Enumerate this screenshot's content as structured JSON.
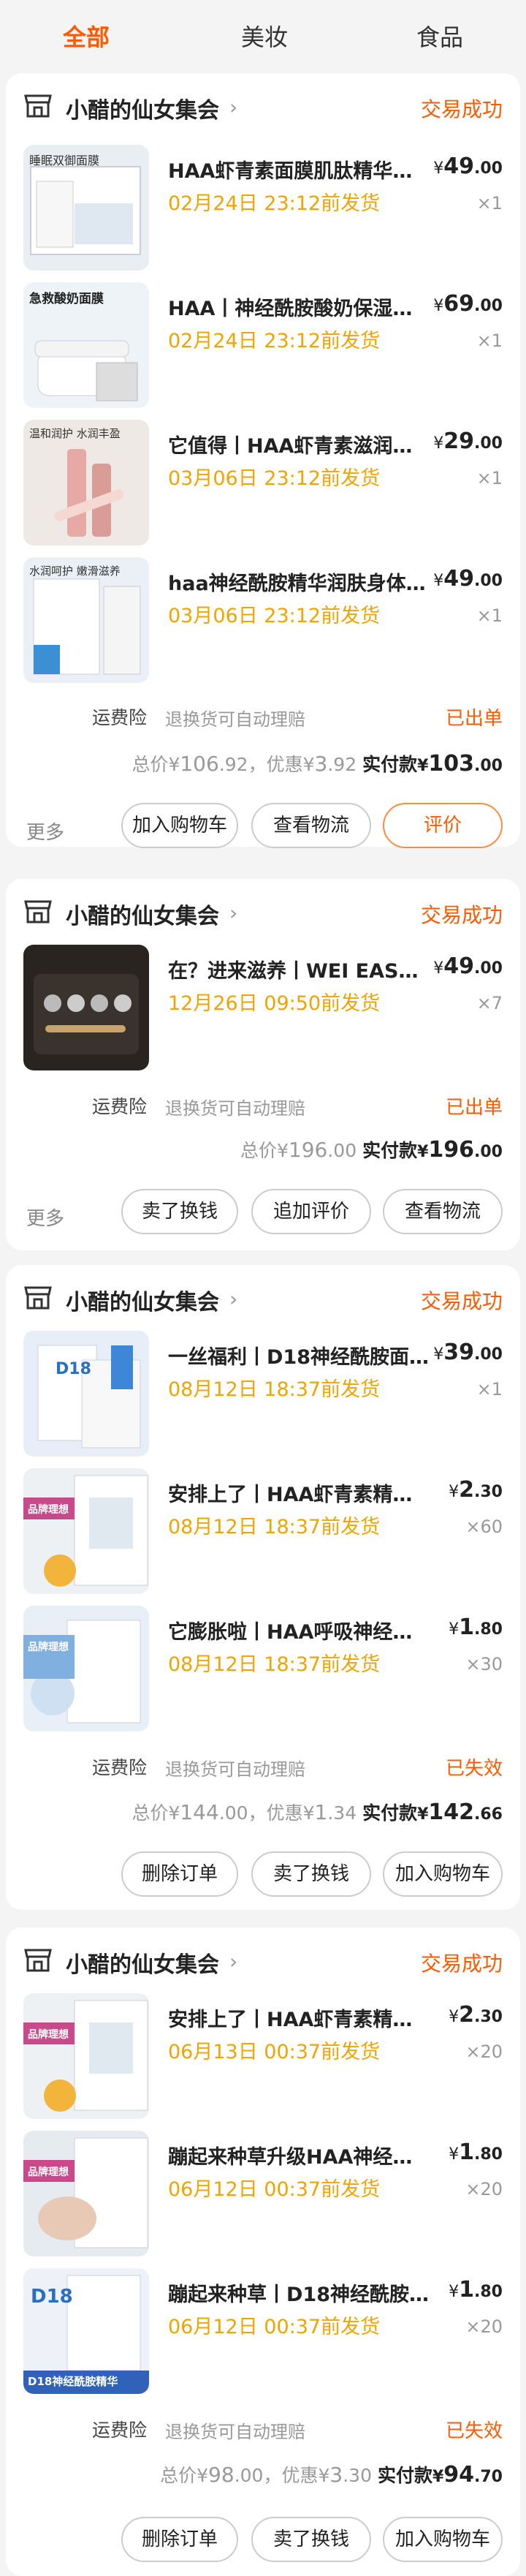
{
  "tabs": [
    {
      "label": "全部",
      "active": true
    },
    {
      "label": "美妆",
      "active": false
    },
    {
      "label": "食品",
      "active": false
    }
  ],
  "orders": [
    {
      "shop": "小醋的仙女集会",
      "status": "交易成功",
      "items": [
        {
          "title": "HAA虾青素面膜肌肽精华亢…",
          "ship": "02月24日 23:12前发货",
          "price_int": "49",
          "price_dec": ".00",
          "qty": "×1",
          "thumb_caption": "睡眠双御面膜"
        },
        {
          "title": "HAA丨神经酰胺酸奶保湿面…",
          "ship": "02月24日 23:12前发货",
          "price_int": "69",
          "price_dec": ".00",
          "qty": "×1",
          "thumb_caption": "急救酸奶面膜"
        },
        {
          "title": "它值得丨HAA虾青素滋润唇…",
          "ship": "03月06日 23:12前发货",
          "price_int": "29",
          "price_dec": ".00",
          "qty": "×1",
          "thumb_caption": "温和润护 水润丰盈"
        },
        {
          "title": "haa神经酰胺精华润肤身体…",
          "ship": "03月06日 23:12前发货",
          "price_int": "49",
          "price_dec": ".00",
          "qty": "×1",
          "thumb_caption": "水润呵护 嫩滑滋养"
        }
      ],
      "insurance": "运费险",
      "policy": "退换货可自动理赔",
      "shipping_state": "已出单",
      "total_label": "总价",
      "total_int": "106",
      "total_dec": ".92",
      "discount_label": "优惠",
      "discount_int": "3",
      "discount_dec": ".92",
      "paid_label": "实付款",
      "paid_int": "103",
      "paid_dec": ".00",
      "more": "更多",
      "actions": [
        "加入购物车",
        "查看物流",
        "评价"
      ]
    },
    {
      "shop": "小醋的仙女集会",
      "status": "交易成功",
      "items": [
        {
          "title": "在？进来滋养丨WEI EAST/…",
          "ship": "12月26日 09:50前发货",
          "price_int": "49",
          "price_dec": ".00",
          "qty": "×7",
          "thumb_caption": ""
        }
      ],
      "insurance": "运费险",
      "policy": "退换货可自动理赔",
      "shipping_state": "已出单",
      "total_label": "总价",
      "total_int": "196",
      "total_dec": ".00",
      "paid_label": "实付款",
      "paid_int": "196",
      "paid_dec": ".00",
      "more": "更多",
      "actions": [
        "卖了换钱",
        "追加评价",
        "查看物流"
      ]
    },
    {
      "shop": "小醋的仙女集会",
      "status": "交易成功",
      "items": [
        {
          "title": "一丝福利丨D18神经酰胺面…",
          "ship": "08月12日 18:37前发货",
          "price_int": "39",
          "price_dec": ".00",
          "qty": "×1",
          "thumb_caption": "D18"
        },
        {
          "title": "安排上了丨HAA虾青素精华…",
          "ship": "08月12日 18:37前发货",
          "price_int": "2",
          "price_dec": ".30",
          "qty": "×60",
          "thumb_caption": "品牌理想"
        },
        {
          "title": "它膨胀啦丨HAA呼吸神经酰…",
          "ship": "08月12日 18:37前发货",
          "price_int": "1",
          "price_dec": ".80",
          "qty": "×30",
          "thumb_caption": "品牌理想"
        }
      ],
      "insurance": "运费险",
      "policy": "退换货可自动理赔",
      "shipping_state": "已失效",
      "total_label": "总价",
      "total_int": "144",
      "total_dec": ".00",
      "discount_label": "优惠",
      "discount_int": "1",
      "discount_dec": ".34",
      "paid_label": "实付款",
      "paid_int": "142",
      "paid_dec": ".66",
      "more": "",
      "actions": [
        "删除订单",
        "卖了换钱",
        "加入购物车"
      ]
    },
    {
      "shop": "小醋的仙女集会",
      "status": "交易成功",
      "items": [
        {
          "title": "安排上了丨HAA虾青素精华…",
          "ship": "06月13日 00:37前发货",
          "price_int": "2",
          "price_dec": ".30",
          "qty": "×20",
          "thumb_caption": "品牌理想"
        },
        {
          "title": "蹦起来种草升级HAA神经酰…",
          "ship": "06月12日 00:37前发货",
          "price_int": "1",
          "price_dec": ".80",
          "qty": "×20",
          "thumb_caption": "品牌理想"
        },
        {
          "title": "蹦起来种草丨D18神经酰胺…",
          "ship": "06月12日 00:37前发货",
          "price_int": "1",
          "price_dec": ".80",
          "qty": "×20",
          "thumb_caption": "D18神经酰胺精华"
        }
      ],
      "insurance": "运费险",
      "policy": "退换货可自动理赔",
      "shipping_state": "已失效",
      "total_label": "总价",
      "total_int": "98",
      "total_dec": ".00",
      "discount_label": "优惠",
      "discount_int": "3",
      "discount_dec": ".30",
      "paid_label": "实付款",
      "paid_int": "94",
      "paid_dec": ".70",
      "more": "",
      "actions": [
        "删除订单",
        "卖了换钱",
        "加入购物车"
      ]
    }
  ],
  "currency": "¥",
  "colors": {
    "accent": "#ff5a00",
    "ship_time": "#f0a400",
    "background": "#f4f4f4"
  }
}
